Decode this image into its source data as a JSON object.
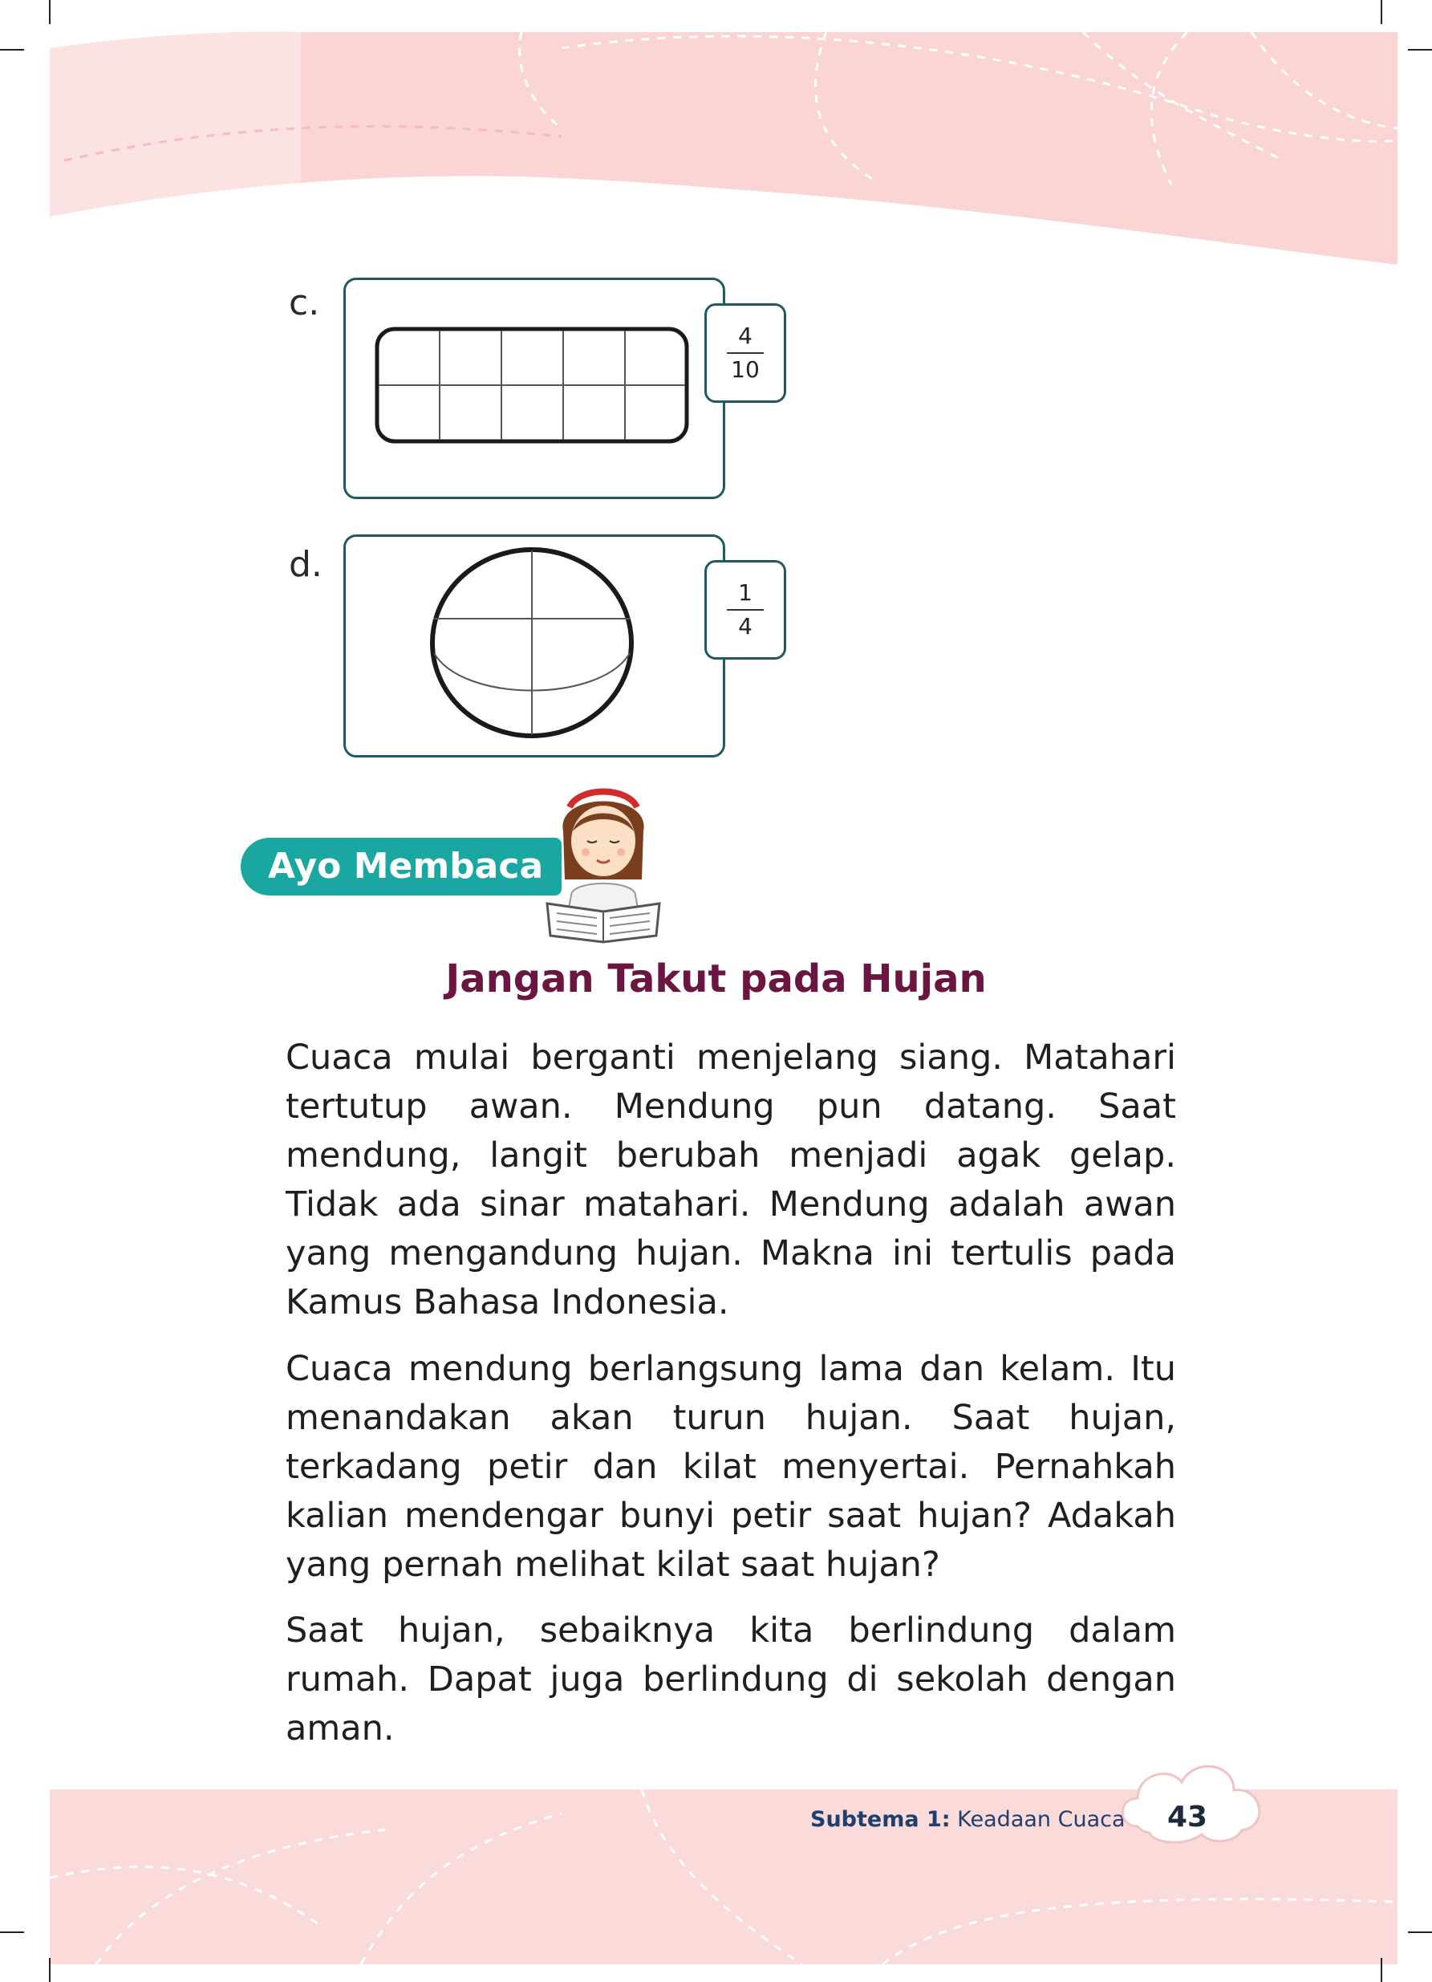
{
  "colors": {
    "header_pink": "#f9d0d0",
    "box_border": "#1f5a66",
    "badge_teal": "#1aa7a2",
    "title_maroon": "#6a1640",
    "footer_text": "#1f3f6e"
  },
  "exercise": {
    "c": {
      "label": "c.",
      "numerator": "4",
      "denominator": "10",
      "shape": "rounded-rectangle divided into 10 parts"
    },
    "d": {
      "label": "d.",
      "numerator": "1",
      "denominator": "4",
      "shape": "oval divided into 4 parts"
    }
  },
  "section_badge": "Ayo Membaca",
  "reading": {
    "title": "Jangan Takut pada Hujan",
    "paragraphs": [
      "Cuaca mulai berganti menjelang siang. Matahari tertutup awan. Mendung pun datang. Saat mendung, langit berubah menjadi agak gelap. Tidak ada sinar matahari. Mendung adalah awan yang mengandung hujan. Makna ini tertulis pada Kamus Bahasa Indonesia.",
      "Cuaca mendung berlangsung lama dan kelam. Itu menandakan akan turun hujan. Saat hujan, terkadang petir dan kilat menyertai. Pernahkah kalian mendengar bunyi petir saat hujan? Adakah yang pernah melihat kilat saat hujan?",
      "Saat hujan, sebaiknya kita berlindung dalam rumah. Dapat juga berlindung di sekolah dengan aman."
    ]
  },
  "footer": {
    "subtheme_label": "Subtema 1:",
    "subtheme_name": "Keadaan Cuaca",
    "page_number": "43"
  }
}
